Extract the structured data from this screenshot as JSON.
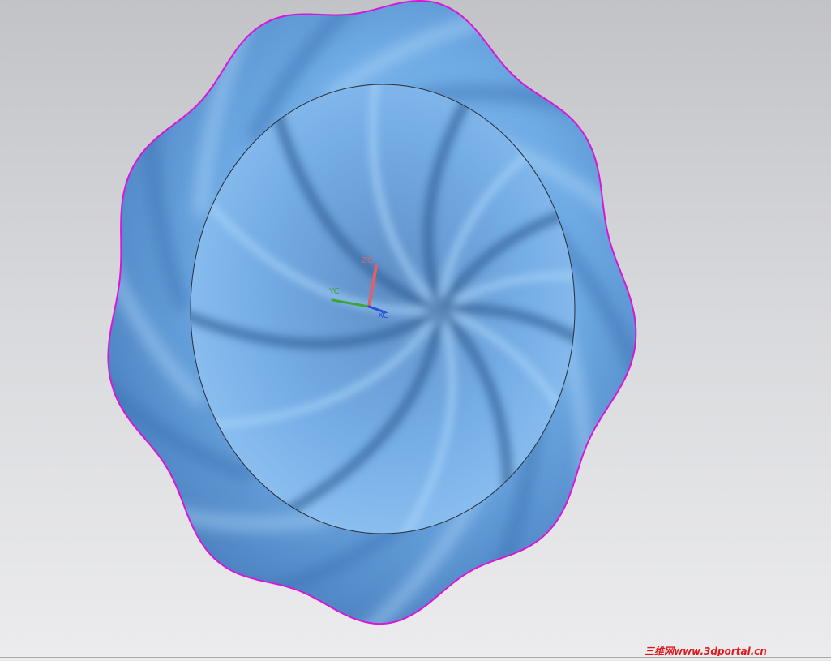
{
  "viewport": {
    "background_top": "#c2c3c7",
    "background_bottom": "#ececee"
  },
  "model": {
    "surface_color": "#6aa8e6",
    "edge_color": "#d816d8",
    "inner_circle_color": "#2a2e35",
    "folds": 14
  },
  "triad": {
    "zc_label": "ZC",
    "yc_label": "YC",
    "xc_label": "XC",
    "zc_color": "#e2606a",
    "yc_color": "#3aa63a",
    "xc_color": "#2850d8"
  },
  "watermark": {
    "text": "三维网www.3dportal.cn",
    "color": "#e0181e"
  }
}
